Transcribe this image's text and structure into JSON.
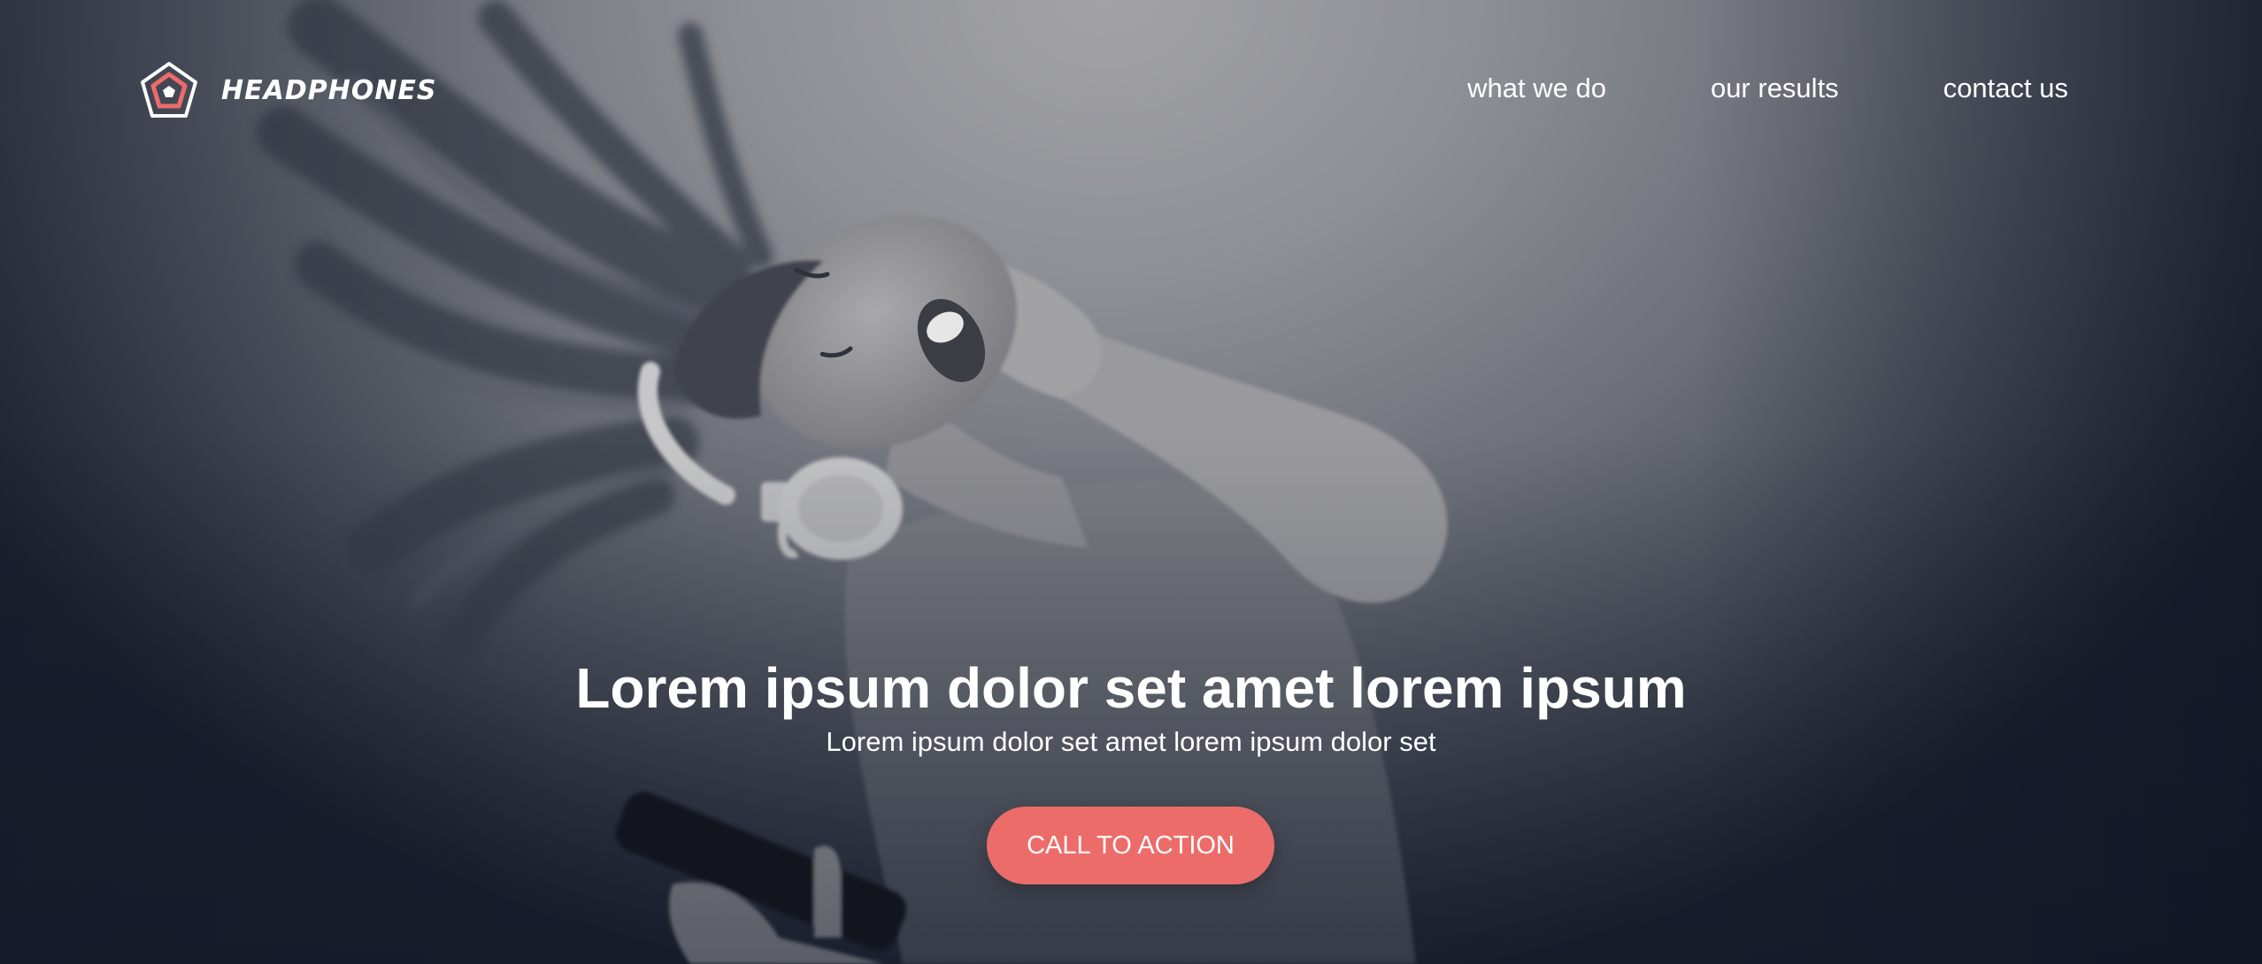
{
  "brand": {
    "name": "HEADPHONES",
    "logo_icon": "pentagon-logo-icon",
    "accent_color": "#ec6c6a"
  },
  "nav": {
    "items": [
      {
        "label": "what we do"
      },
      {
        "label": "our results"
      },
      {
        "label": "contact us"
      }
    ]
  },
  "hero": {
    "image": "woman-with-headphones-photo",
    "title": "Lorem ipsum dolor set amet lorem ipsum",
    "subtitle": "Lorem ipsum dolor set amet lorem ipsum dolor set",
    "cta_label": "CALL TO ACTION",
    "cta_color": "#ec6c6a"
  }
}
